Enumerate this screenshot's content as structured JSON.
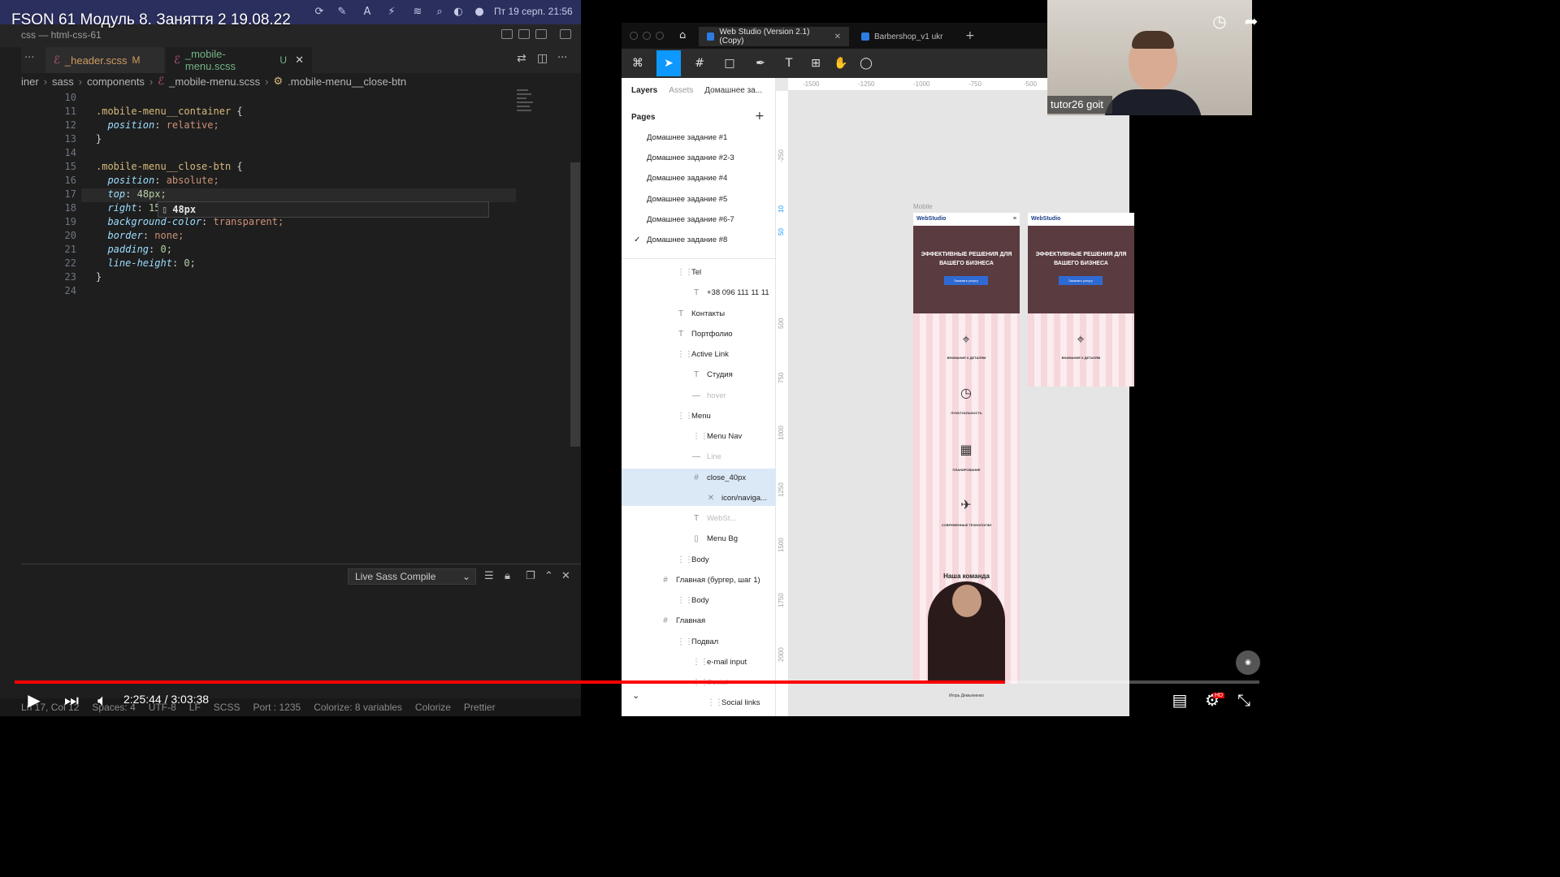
{
  "video": {
    "title": "FSON 61 Модуль 8. Заняття 2 19.08.22",
    "time": "2:25:44 / 3:03:38",
    "progress": 0.796
  },
  "macos": {
    "clock": "Пт 19 серп.  21:56"
  },
  "vscode": {
    "window_title": "css — html-css-61",
    "tabs": [
      {
        "label": "_header.scss",
        "badge": "M"
      },
      {
        "label": "_mobile-menu.scss",
        "badge": "U"
      }
    ],
    "breadcrumb": [
      "iner",
      "sass",
      "components",
      "_mobile-menu.scss",
      ".mobile-menu__close-btn"
    ],
    "suggestion": "48px",
    "panel_select": "Live Sass Compile",
    "status": {
      "position": "Ln 17, Col 12",
      "spaces": "Spaces: 4",
      "encoding": "UTF-8",
      "eol": "LF",
      "language": "SCSS",
      "port": "Port : 1235",
      "colorize_vars": "Colorize: 8 variables",
      "colorize": "Colorize",
      "prettier": "Prettier"
    }
  },
  "code_lines": [
    {
      "n": "10",
      "text": ""
    },
    {
      "n": "11",
      "text": ".mobile-menu__container {"
    },
    {
      "n": "12",
      "text": "  position: relative;"
    },
    {
      "n": "13",
      "text": "}"
    },
    {
      "n": "14",
      "text": ""
    },
    {
      "n": "15",
      "text": ".mobile-menu__close-btn {"
    },
    {
      "n": "16",
      "text": "  position: absolute;"
    },
    {
      "n": "17",
      "text": "  top: 48px;"
    },
    {
      "n": "18",
      "text": "  right: 15"
    },
    {
      "n": "19",
      "text": "  background-color: transparent;"
    },
    {
      "n": "20",
      "text": "  border: none;"
    },
    {
      "n": "21",
      "text": "  padding: 0;"
    },
    {
      "n": "22",
      "text": "  line-height: 0;"
    },
    {
      "n": "23",
      "text": "}"
    },
    {
      "n": "24",
      "text": ""
    }
  ],
  "figma": {
    "tabs": [
      "Web Studio (Version 2.1) (Copy)",
      "Barbershop_v1 ukr"
    ],
    "panel_tabs": [
      "Layers",
      "Assets",
      "Домашнее за..."
    ],
    "pages_title": "Pages",
    "pages": [
      "Домашнее задание #1",
      "Домашнее задание #2-3",
      "Домашнее задание #4",
      "Домашнее задание #5",
      "Домашнее задание #6-7",
      "Домашнее задание #8"
    ],
    "layers": [
      {
        "label": "Tel",
        "icon": "frame-icon"
      },
      {
        "label": "+38 096 111 11 11",
        "icon": "text-icon"
      },
      {
        "label": "Контакты",
        "icon": "text-icon"
      },
      {
        "label": "Портфолио",
        "icon": "text-icon"
      },
      {
        "label": "Active Link",
        "icon": "frame-icon"
      },
      {
        "label": "Студия",
        "icon": "text-icon"
      },
      {
        "label": "hover",
        "icon": "line-icon"
      },
      {
        "label": "Menu",
        "icon": "frame-icon"
      },
      {
        "label": "Menu Nav",
        "icon": "frame-icon"
      },
      {
        "label": "Line",
        "icon": "line-icon"
      },
      {
        "label": "close_40px",
        "icon": "hash-icon"
      },
      {
        "label": "icon/naviga...",
        "icon": "close-icon"
      },
      {
        "label": "WebSt...",
        "icon": "text-icon"
      },
      {
        "label": "Menu Bg",
        "icon": "rect-icon"
      },
      {
        "label": "Body",
        "icon": "frame-icon"
      },
      {
        "label": "Главная (бургер, шаг 1)",
        "icon": "hash-icon"
      },
      {
        "label": "Body",
        "icon": "frame-icon"
      },
      {
        "label": "Главная",
        "icon": "hash-icon"
      },
      {
        "label": "Подвал",
        "icon": "frame-icon"
      },
      {
        "label": "e-mail input",
        "icon": "frame-icon"
      },
      {
        "label": "Social",
        "icon": "frame-icon"
      },
      {
        "label": "Social links",
        "icon": "frame-icon"
      }
    ],
    "ruler_top": [
      "-1500",
      "-1250",
      "-1000",
      "-750",
      "-500"
    ],
    "ruler_left": [
      "-250",
      "10",
      "50",
      "500",
      "750",
      "1000",
      "1250",
      "1500",
      "1750",
      "2000"
    ],
    "frame_label": "Mobile",
    "brand": "WebStudio",
    "hero_title": "ЭФФЕКТИВНЫЕ РЕШЕНИЯ ДЛЯ ВАШЕГО БИЗНЕСА",
    "hero_button": "Заказать услугу",
    "features": [
      "ВНИМАНИЕ К ДЕТАЛЯМ",
      "ПУНКТУАЛЬНОСТЬ",
      "ПЛАНИРОВАНИЕ",
      "СОВРЕМЕННЫЕ ТЕХНОЛОГИИ"
    ],
    "team_title": "Наша команда",
    "team_name": "Игорь Демьяненко"
  },
  "webcam": {
    "name": "tutor26 goit"
  }
}
